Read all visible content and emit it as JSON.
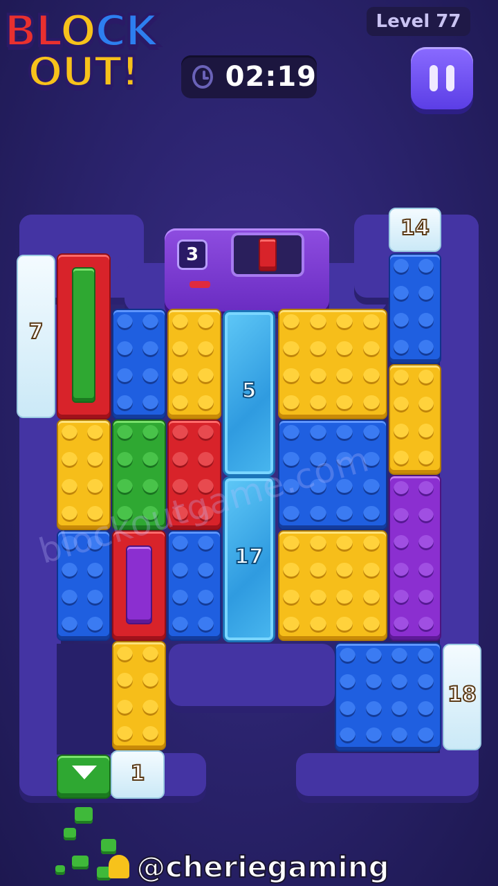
{
  "logo": {
    "line1": [
      "BL",
      "O",
      "CK"
    ],
    "line2": "OUT!"
  },
  "timer": {
    "value": "02:19",
    "icon": "clock-icon"
  },
  "level": {
    "label": "Level 77"
  },
  "pause": {
    "icon": "pause-icon"
  },
  "machine": {
    "count": "3",
    "target_color": "#d8232a"
  },
  "counters": {
    "left_snow": "7",
    "top_right_snow": "14",
    "ice_upper": "5",
    "ice_lower": "17",
    "right_snow": "18",
    "bottom_snow": "1"
  },
  "watermark": "blockoutgame.com",
  "footer": {
    "handle": "@cheriegaming",
    "icon": "bell-icon"
  },
  "colors": {
    "red": "#d8232a",
    "blue": "#1f5fe0",
    "yellow": "#f6be1a",
    "green": "#2fa832",
    "purple": "#8b2fd0",
    "board": "#4434a3"
  }
}
